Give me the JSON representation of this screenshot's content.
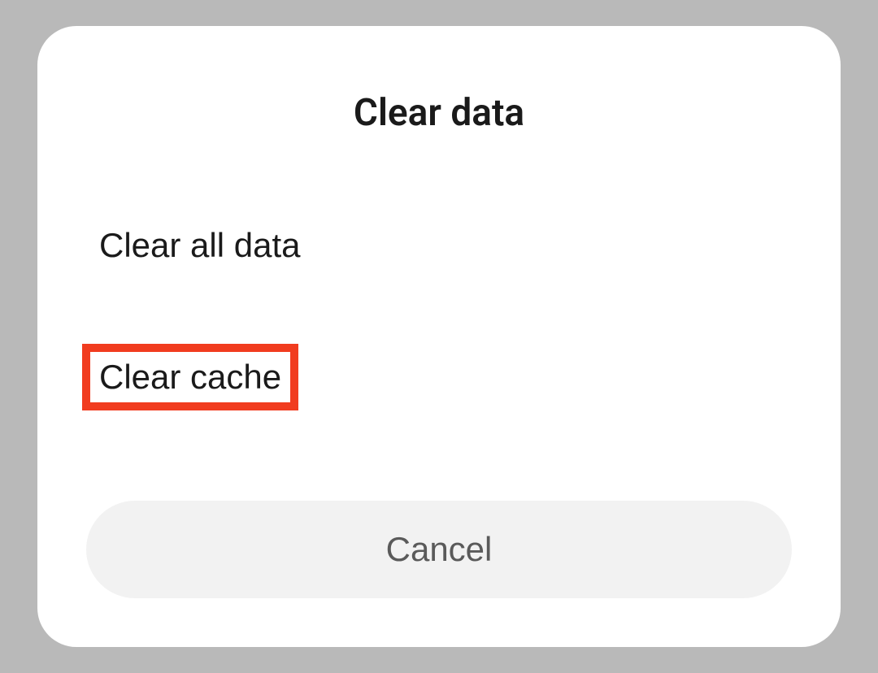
{
  "dialog": {
    "title": "Clear data",
    "options": [
      {
        "label": "Clear all data"
      },
      {
        "label": "Clear cache"
      }
    ],
    "cancel_label": "Cancel"
  },
  "colors": {
    "highlight": "#f13c1f",
    "background": "#b9b9b9",
    "dialog_bg": "#ffffff",
    "cancel_bg": "#f2f2f2"
  }
}
